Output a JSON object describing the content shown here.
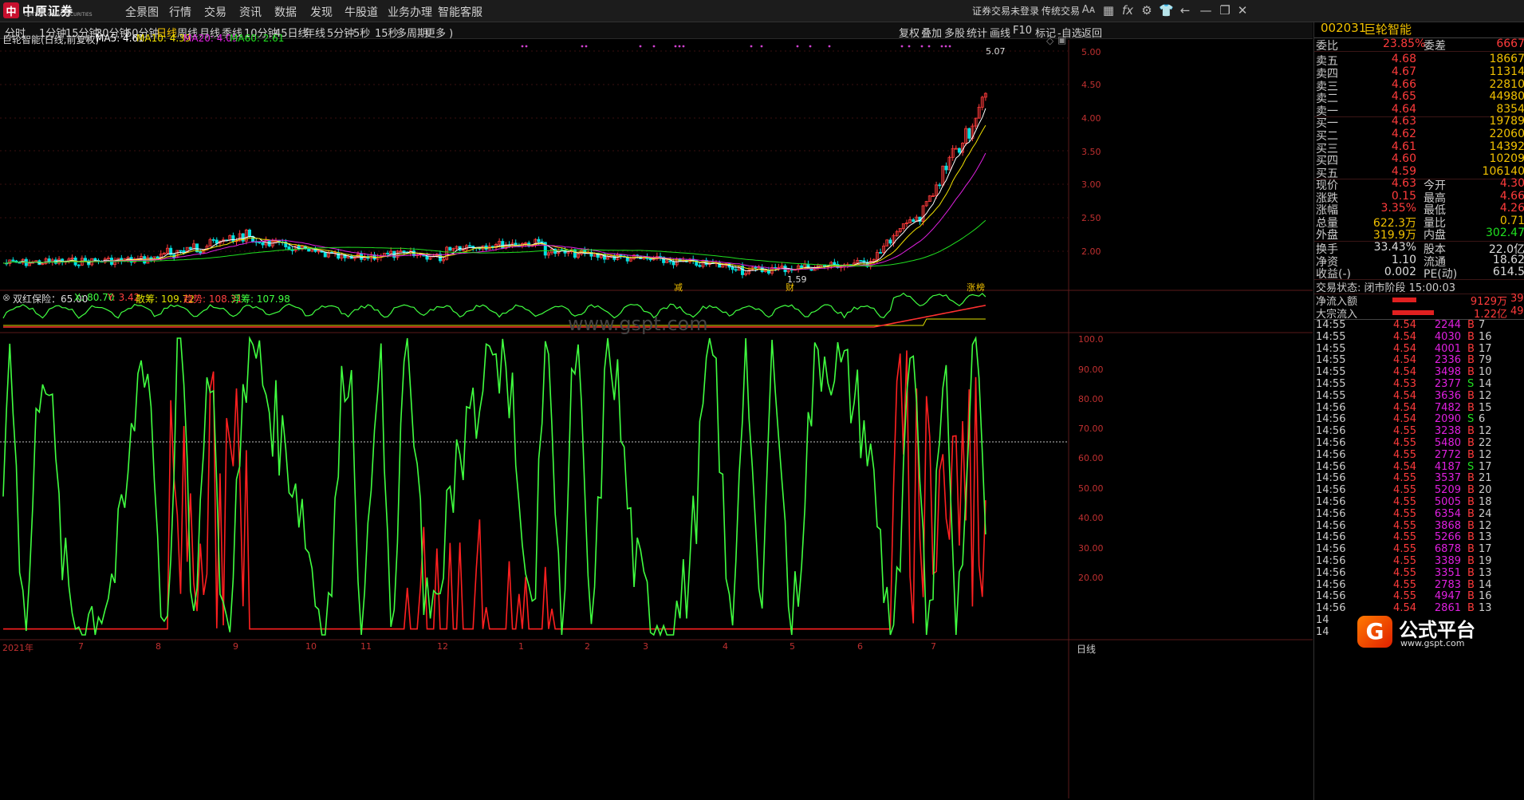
{
  "menubar": {
    "logo_text": "中原证券",
    "logo_sub": "CENTRAL CHINA SECURITIES",
    "items": [
      "全景图",
      "行情",
      "交易",
      "资讯",
      "数据",
      "发现",
      "牛股道",
      "业务办理",
      "智能客服"
    ],
    "login_status": "证券交易未登录",
    "mode": "传统交易",
    "icons": [
      "font-size-icon",
      "grid-icon",
      "formula-icon",
      "gear-icon",
      "shirt-icon",
      "back-arrow-icon",
      "minimize-icon",
      "restore-icon",
      "close-icon"
    ]
  },
  "periodbar": {
    "periods": [
      "分时",
      "1分钟",
      "15分钟",
      "30分钟",
      "60分钟",
      "日线",
      "周线",
      "月线",
      "季线",
      "10分钟",
      "45日线",
      "年线",
      "5分钟",
      "5秒",
      "15秒",
      "多周期",
      "更多 )"
    ],
    "active": "日线",
    "tools": [
      "复权",
      "叠加",
      "多股",
      "统计",
      "画线",
      "F10",
      "标记",
      "-自选",
      "返回"
    ]
  },
  "main": {
    "title": "巨轮智能(日线,前复权)",
    "ma5": "MA5: 4.61",
    "ma10": "MA10: 4.39",
    "ma20": "MA20: 4.09",
    "ma60": "MA60: 2.61",
    "high_label": "5.07",
    "low_label": "1.59",
    "event_labels": [
      "减",
      "财",
      "涨",
      "榜"
    ],
    "yaxis": [
      "5.00",
      "4.50",
      "4.00",
      "3.50",
      "3.00",
      "2.50",
      "2.00"
    ],
    "colors": {
      "ma5": "#ffffff",
      "ma10": "#f0e000",
      "ma20": "#e020e0",
      "ma60": "#20e020",
      "up": "#ff3b3b",
      "down": "#00e0e0"
    }
  },
  "indicator": {
    "name": "双红保险：65.00",
    "x": "X: 80.70",
    "y": "Y: 3.42",
    "sanchou": "散筹: 109.72",
    "qushi": "趋势: 108.31",
    "fuchou": "浮筹: 107.98",
    "yaxis": [
      "100.0",
      "90.00",
      "80.00",
      "70.00",
      "60.00",
      "50.00",
      "40.00",
      "30.00",
      "20.00"
    ],
    "watermark": "www.gspt.com"
  },
  "xaxis": [
    "2021年",
    "7",
    "8",
    "9",
    "10",
    "11",
    "12",
    "1",
    "2",
    "3",
    "4",
    "5",
    "6",
    "7"
  ],
  "xaxis_right": "日线",
  "quote": {
    "code": "002031",
    "name": "巨轮智能",
    "webi_label": "委比",
    "webi": "23.85%",
    "wecha_label": "委差",
    "wecha": "6667",
    "sells": [
      {
        "label": "卖五",
        "price": "4.68",
        "vol": "18667"
      },
      {
        "label": "卖四",
        "price": "4.67",
        "vol": "11314"
      },
      {
        "label": "卖三",
        "price": "4.66",
        "vol": "22810"
      },
      {
        "label": "卖二",
        "price": "4.65",
        "vol": "44980"
      },
      {
        "label": "卖一",
        "price": "4.64",
        "vol": "8354"
      }
    ],
    "buys": [
      {
        "label": "买一",
        "price": "4.63",
        "vol": "19789"
      },
      {
        "label": "买二",
        "price": "4.62",
        "vol": "22060"
      },
      {
        "label": "买三",
        "price": "4.61",
        "vol": "14392"
      },
      {
        "label": "买四",
        "price": "4.60",
        "vol": "10209"
      },
      {
        "label": "买五",
        "price": "4.59",
        "vol": "106140"
      }
    ],
    "stats": [
      {
        "l1": "现价",
        "v1": "4.63",
        "l2": "今开",
        "v2": "4.30"
      },
      {
        "l1": "涨跌",
        "v1": "0.15",
        "l2": "最高",
        "v2": "4.66"
      },
      {
        "l1": "涨幅",
        "v1": "3.35%",
        "l2": "最低",
        "v2": "4.26"
      },
      {
        "l1": "总量",
        "v1": "622.3万",
        "l2": "量比",
        "v2": "0.71"
      },
      {
        "l1": "外盘",
        "v1": "319.9万",
        "l2": "内盘",
        "v2": "302.47"
      }
    ],
    "stats2": [
      {
        "l1": "换手",
        "v1": "33.43%",
        "l2": "股本",
        "v2": "22.0亿"
      },
      {
        "l1": "净资",
        "v1": "1.10",
        "l2": "流通",
        "v2": "18.62"
      },
      {
        "l1": "收益(-)",
        "v1": "0.002",
        "l2": "PE(动)",
        "v2": "614.5"
      }
    ],
    "status": "交易状态: 闭市阶段 15:00:03",
    "netflow_label": "净流入额",
    "netflow": "9129万",
    "netflow_r": "39",
    "bigflow_label": "大宗流入",
    "bigflow": "1.22亿",
    "bigflow_r": "49",
    "ticks": [
      {
        "t": "14:55",
        "p": "4.54",
        "v": "2244",
        "s": "B",
        "r": "7"
      },
      {
        "t": "14:55",
        "p": "4.54",
        "v": "4030",
        "s": "B",
        "r": "16"
      },
      {
        "t": "14:55",
        "p": "4.54",
        "v": "4001",
        "s": "B",
        "r": "17"
      },
      {
        "t": "14:55",
        "p": "4.54",
        "v": "2336",
        "s": "B",
        "r": "79"
      },
      {
        "t": "14:55",
        "p": "4.54",
        "v": "3498",
        "s": "B",
        "r": "10"
      },
      {
        "t": "14:55",
        "p": "4.53",
        "v": "2377",
        "s": "S",
        "r": "14"
      },
      {
        "t": "14:55",
        "p": "4.54",
        "v": "3636",
        "s": "B",
        "r": "12"
      },
      {
        "t": "14:56",
        "p": "4.54",
        "v": "7482",
        "s": "B",
        "r": "15"
      },
      {
        "t": "14:56",
        "p": "4.54",
        "v": "2090",
        "s": "S",
        "r": "6"
      },
      {
        "t": "14:56",
        "p": "4.55",
        "v": "3238",
        "s": "B",
        "r": "12"
      },
      {
        "t": "14:56",
        "p": "4.55",
        "v": "5480",
        "s": "B",
        "r": "22"
      },
      {
        "t": "14:56",
        "p": "4.55",
        "v": "2772",
        "s": "B",
        "r": "12"
      },
      {
        "t": "14:56",
        "p": "4.54",
        "v": "4187",
        "s": "S",
        "r": "17"
      },
      {
        "t": "14:56",
        "p": "4.55",
        "v": "3537",
        "s": "B",
        "r": "21"
      },
      {
        "t": "14:56",
        "p": "4.55",
        "v": "5209",
        "s": "B",
        "r": "20"
      },
      {
        "t": "14:56",
        "p": "4.55",
        "v": "5005",
        "s": "B",
        "r": "18"
      },
      {
        "t": "14:56",
        "p": "4.55",
        "v": "6354",
        "s": "B",
        "r": "24"
      },
      {
        "t": "14:56",
        "p": "4.55",
        "v": "3868",
        "s": "B",
        "r": "12"
      },
      {
        "t": "14:56",
        "p": "4.55",
        "v": "5266",
        "s": "B",
        "r": "13"
      },
      {
        "t": "14:56",
        "p": "4.55",
        "v": "6878",
        "s": "B",
        "r": "17"
      },
      {
        "t": "14:56",
        "p": "4.55",
        "v": "3389",
        "s": "B",
        "r": "19"
      },
      {
        "t": "14:56",
        "p": "4.55",
        "v": "3351",
        "s": "B",
        "r": "13"
      },
      {
        "t": "14:56",
        "p": "4.55",
        "v": "2783",
        "s": "B",
        "r": "14"
      },
      {
        "t": "14:56",
        "p": "4.55",
        "v": "4947",
        "s": "B",
        "r": "16"
      },
      {
        "t": "14:56",
        "p": "4.54",
        "v": "2861",
        "s": "B",
        "r": "13"
      },
      {
        "t": "14",
        "p": "",
        "v": "",
        "s": "",
        "r": ""
      },
      {
        "t": "14",
        "p": "",
        "v": "",
        "s": "",
        "r": ""
      }
    ],
    "badge": "公式平台",
    "badge_sub": "www.gspt.com"
  }
}
